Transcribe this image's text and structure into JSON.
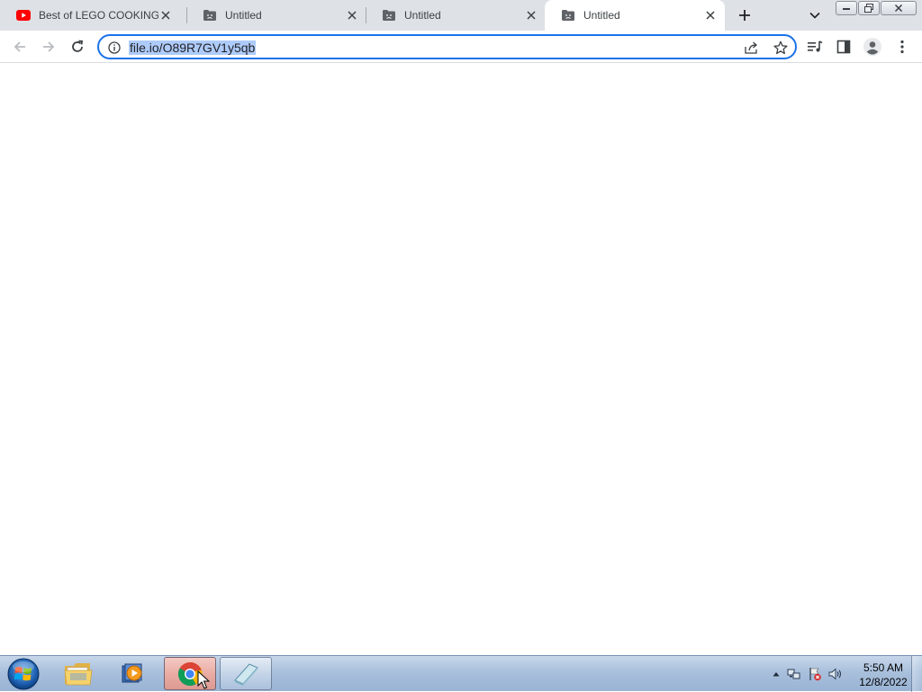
{
  "browser": {
    "tabs": [
      {
        "title": "Best of LEGO COOKING: С",
        "favicon": "youtube-icon",
        "active": false
      },
      {
        "title": "Untitled",
        "favicon": "sad-folder-icon",
        "active": false
      },
      {
        "title": "Untitled",
        "favicon": "sad-folder-icon",
        "active": false
      },
      {
        "title": "Untitled",
        "favicon": "sad-folder-icon",
        "active": true
      }
    ],
    "address_bar": {
      "url": "file.io/O89R7GV1y5qb",
      "selected": true
    },
    "icons": {
      "back": "back-arrow-icon",
      "forward": "forward-arrow-icon",
      "reload": "reload-icon",
      "site_info": "info-icon",
      "share": "share-icon",
      "bookmark": "star-icon",
      "media": "media-queue-icon",
      "side_panel": "side-panel-icon",
      "profile": "profile-icon",
      "menu": "kebab-menu-icon"
    },
    "accent_color": "#1a73e8"
  },
  "taskbar": {
    "apps": [
      {
        "name": "windows-explorer",
        "icon": "folder-icon",
        "running": false
      },
      {
        "name": "media-player",
        "icon": "media-player-icon",
        "running": false
      },
      {
        "name": "google-chrome",
        "icon": "chrome-icon",
        "running": true,
        "active": true
      },
      {
        "name": "notepad",
        "icon": "notepad-icon",
        "running": true,
        "active": false
      }
    ],
    "clock": {
      "time": "5:50 AM",
      "date": "12/8/2022"
    }
  }
}
